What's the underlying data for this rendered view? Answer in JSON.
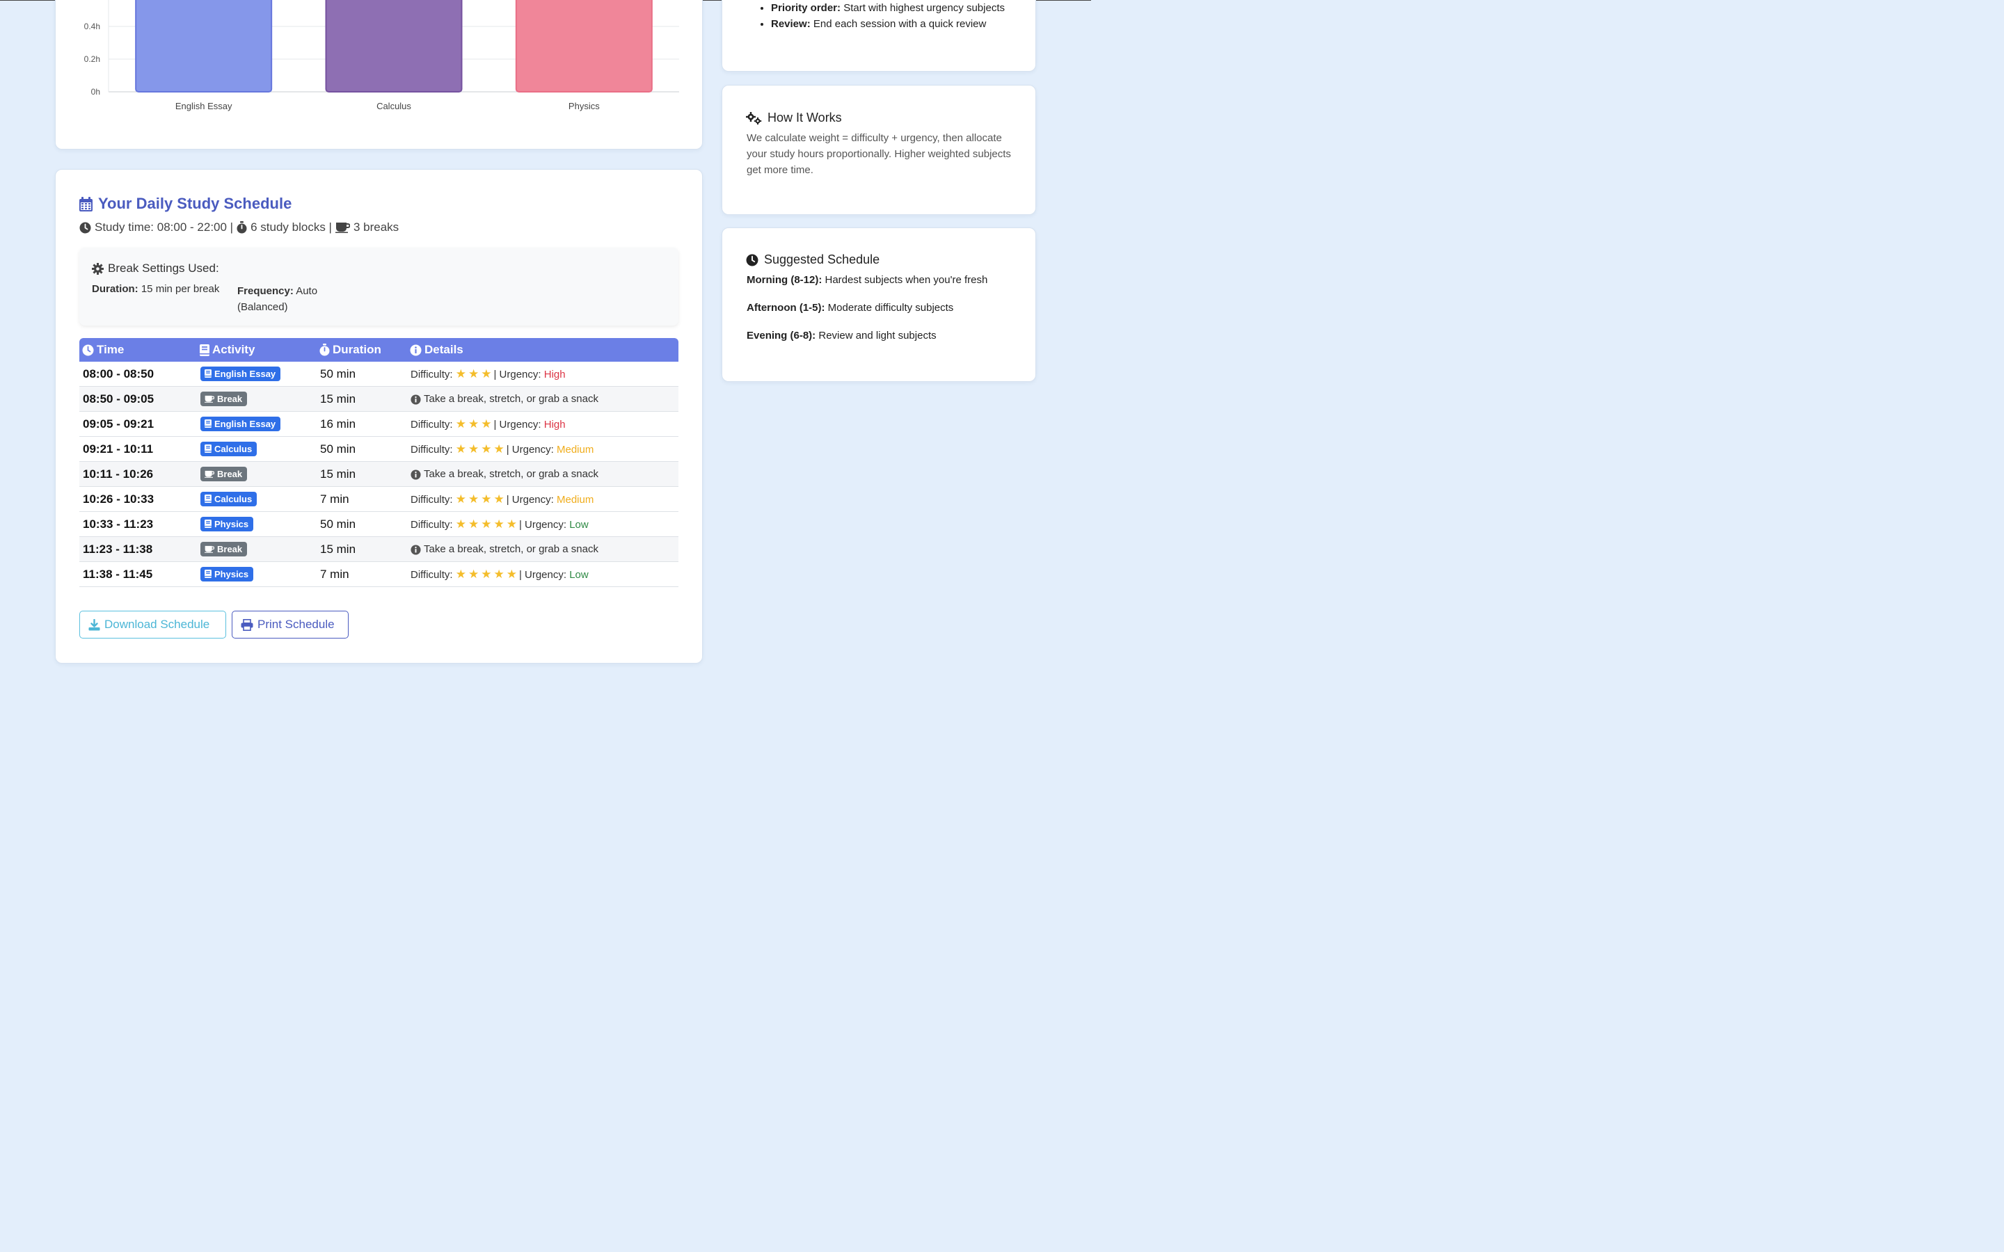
{
  "chart": {
    "y_ticks": [
      "0h",
      "0.2h",
      "0.4h"
    ],
    "categories": [
      "English Essay",
      "Calculus",
      "Physics"
    ]
  },
  "chart_data": {
    "type": "bar",
    "categories": [
      "English Essay",
      "Calculus",
      "Physics"
    ],
    "values": [
      0.6,
      0.6,
      0.6
    ],
    "ylabel": "",
    "y_tick_labels": [
      "0h",
      "0.2h",
      "0.4h"
    ],
    "ylim": [
      0,
      0.5
    ],
    "grid": true,
    "colors": [
      "#8597ea",
      "#8e6fb3",
      "#f08699"
    ],
    "note_visible": "bars extend above visible area"
  },
  "schedule": {
    "title": "Your Daily Study Schedule",
    "study_time": "Study time: 08:00 - 22:00 |",
    "blocks": "6 study blocks |",
    "breaks": "3 breaks",
    "break_settings_title": "Break Settings Used:",
    "duration_label": "Duration:",
    "duration_value": "15 min per break",
    "frequency_label": "Frequency:",
    "frequency_value": "Auto (Balanced)",
    "headers": {
      "time": "Time",
      "activity": "Activity",
      "duration": "Duration",
      "details": "Details"
    },
    "rows": [
      {
        "time": "08:00 - 08:50",
        "activity": "English Essay",
        "type": "study",
        "duration": "50 min",
        "difficulty_label": "Difficulty:",
        "stars": "★★★",
        "urgency_label": "| Urgency:",
        "urgency": "High",
        "level": "high"
      },
      {
        "time": "08:50 - 09:05",
        "activity": "Break",
        "type": "break",
        "duration": "15 min",
        "note": "Take a break, stretch, or grab a snack"
      },
      {
        "time": "09:05 - 09:21",
        "activity": "English Essay",
        "type": "study",
        "duration": "16 min",
        "difficulty_label": "Difficulty:",
        "stars": "★★★",
        "urgency_label": "| Urgency:",
        "urgency": "High",
        "level": "high"
      },
      {
        "time": "09:21 - 10:11",
        "activity": "Calculus",
        "type": "study",
        "duration": "50 min",
        "difficulty_label": "Difficulty:",
        "stars": "★★★★",
        "urgency_label": "| Urgency:",
        "urgency": "Medium",
        "level": "med"
      },
      {
        "time": "10:11 - 10:26",
        "activity": "Break",
        "type": "break",
        "duration": "15 min",
        "note": "Take a break, stretch, or grab a snack"
      },
      {
        "time": "10:26 - 10:33",
        "activity": "Calculus",
        "type": "study",
        "duration": "7 min",
        "difficulty_label": "Difficulty:",
        "stars": "★★★★",
        "urgency_label": "| Urgency:",
        "urgency": "Medium",
        "level": "med"
      },
      {
        "time": "10:33 - 11:23",
        "activity": "Physics",
        "type": "study",
        "duration": "50 min",
        "difficulty_label": "Difficulty:",
        "stars": "★★★★★",
        "urgency_label": "| Urgency:",
        "urgency": "Low",
        "level": "low"
      },
      {
        "time": "11:23 - 11:38",
        "activity": "Break",
        "type": "break",
        "duration": "15 min",
        "note": "Take a break, stretch, or grab a snack"
      },
      {
        "time": "11:38 - 11:45",
        "activity": "Physics",
        "type": "study",
        "duration": "7 min",
        "difficulty_label": "Difficulty:",
        "stars": "★★★★★",
        "urgency_label": "| Urgency:",
        "urgency": "Low",
        "level": "low"
      }
    ],
    "download_label": "Download Schedule",
    "print_label": "Print Schedule"
  },
  "tips": {
    "items": [
      {
        "bold": "Priority order:",
        "text": " Start with highest urgency subjects"
      },
      {
        "bold": "Review:",
        "text": " End each session with a quick review"
      }
    ]
  },
  "how": {
    "title": "How It Works",
    "body": "We calculate weight = difficulty + urgency, then allocate your study hours proportionally. Higher weighted subjects get more time."
  },
  "suggested": {
    "title": "Suggested Schedule",
    "lines": [
      {
        "bold": "Morning (8-12):",
        "text": " Hardest subjects when you're fresh"
      },
      {
        "bold": "Afternoon (1-5):",
        "text": " Moderate difficulty subjects"
      },
      {
        "bold": "Evening (6-8):",
        "text": " Review and light subjects"
      }
    ]
  },
  "icons": {
    "calendar": "calendar-icon",
    "clock": "clock-icon",
    "stopwatch": "stopwatch-icon",
    "coffee": "coffee-icon",
    "gear": "gear-icon",
    "book": "book-icon",
    "info": "info-icon",
    "download": "download-icon",
    "print": "print-icon",
    "gears": "gears-icon"
  }
}
